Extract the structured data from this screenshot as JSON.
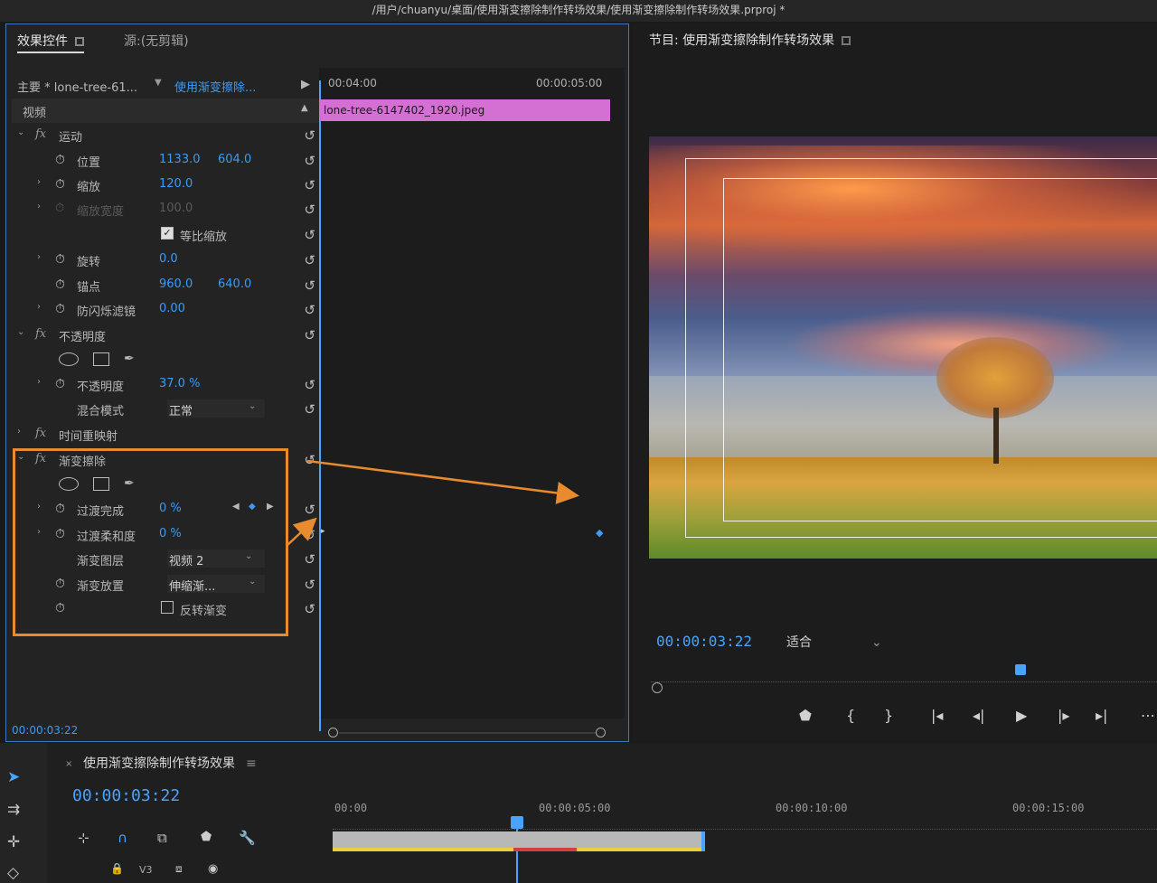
{
  "window": {
    "title": "/用户/chuanyu/桌面/使用渐变擦除制作转场效果/使用渐变擦除制作转场效果.prproj *"
  },
  "effect_controls": {
    "tab_active": "效果控件",
    "tab_source": "源:(无剪辑)",
    "master_label": "主要 * lone-tree-61...",
    "sequence_label": "使用渐变擦除...",
    "time_start": "00:04:00",
    "time_end": "00:00:05:00",
    "clip_name": "lone-tree-6147402_1920.jpeg",
    "section_video": "视频",
    "motion": "运动",
    "position_label": "位置",
    "position_x": "1133.0",
    "position_y": "604.0",
    "scale_label": "缩放",
    "scale_value": "120.0",
    "scale_width_label": "缩放宽度",
    "scale_width_value": "100.0",
    "uniform_scale": "等比缩放",
    "rotation_label": "旋转",
    "rotation_value": "0.0",
    "anchor_label": "锚点",
    "anchor_x": "960.0",
    "anchor_y": "640.0",
    "antiflicker_label": "防闪烁滤镜",
    "antiflicker_value": "0.00",
    "opacity_section": "不透明度",
    "opacity_label": "不透明度",
    "opacity_value": "37.0 %",
    "blend_label": "混合模式",
    "blend_value": "正常",
    "time_remap": "时间重映射",
    "gradient_wipe": "渐变擦除",
    "transition_complete_label": "过渡完成",
    "transition_complete_value": "0 %",
    "transition_softness_label": "过渡柔和度",
    "transition_softness_value": "0 %",
    "gradient_layer_label": "渐变图层",
    "gradient_layer_value": "视频 2",
    "gradient_placement_label": "渐变放置",
    "gradient_placement_value": "伸缩渐...",
    "invert_label": "反转渐变",
    "current_time": "00:00:03:22"
  },
  "program": {
    "title": "节目: 使用渐变擦除制作转场效果",
    "timecode": "00:00:03:22",
    "fit_label": "适合"
  },
  "timeline": {
    "sequence_name": "使用渐变擦除制作转场效果",
    "timecode": "00:00:03:22",
    "ruler": [
      "00:00",
      "00:00:05:00",
      "00:00:10:00",
      "00:00:15:00"
    ],
    "track_v3": "V3"
  }
}
